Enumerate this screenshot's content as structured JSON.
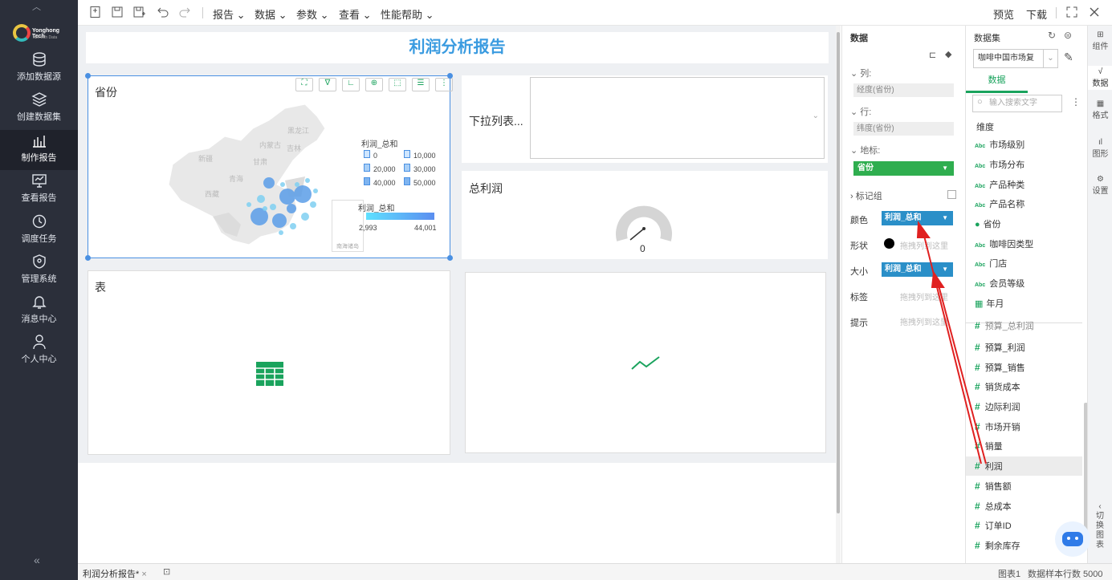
{
  "nav": {
    "logo_text": "Yonghong Tech",
    "logo_sub": "Talk with Data",
    "items": [
      "添加数据源",
      "创建数据集",
      "制作报告",
      "查看报告",
      "调度任务",
      "管理系统",
      "消息中心",
      "个人中心"
    ],
    "collapse": "«"
  },
  "toolbar": {
    "menus": [
      "报告",
      "数据",
      "参数",
      "查看",
      "性能帮助"
    ],
    "preview": "预览",
    "download": "下载"
  },
  "report": {
    "title": "利润分析报告",
    "map_title": "省份",
    "dropdown_label": "下拉列表...",
    "total_profit_title": "总利润",
    "gauge_value": "0",
    "table_title": "表"
  },
  "map": {
    "legend1_title": "利润_总和",
    "legend1_items": [
      "0",
      "10,000",
      "20,000",
      "30,000",
      "40,000",
      "50,000"
    ],
    "legend2_title": "利润_总和",
    "legend2_min": "2,993",
    "legend2_max": "44,001",
    "provinces": [
      "黑龙江",
      "吉林",
      "内蒙古",
      "新疆",
      "青海",
      "西藏",
      "甘肃"
    ],
    "inset": "南海诸岛"
  },
  "pane1": {
    "title": "数据",
    "col_label": "列:",
    "col_value": "经度(省份)",
    "row_label": "行:",
    "row_value": "纬度(省份)",
    "geo_label": "地标:",
    "geo_value": "省份",
    "marks_label": "标记组",
    "color_label": "颜色",
    "color_value": "利润_总和",
    "shape_label": "形状",
    "shape_hint": "拖拽列到这里",
    "size_label": "大小",
    "size_value": "利润_总和",
    "label_label": "标签",
    "label_hint": "拖拽列到这里",
    "tip_label": "提示",
    "tip_hint": "拖拽列到这里"
  },
  "pane2": {
    "title": "数据集",
    "dataset": "咖啡中国市场复",
    "tab": "数据",
    "search_placeholder": "输入搜索文字",
    "dim_title": "维度",
    "dims": [
      "市场级别",
      "市场分布",
      "产品种类",
      "产品名称",
      "省份",
      "咖啡因类型",
      "门店",
      "会员等级",
      "年月"
    ],
    "measures_partial": "预算_总利润",
    "measures": [
      "预算_利润",
      "预算_销售",
      "销货成本",
      "边际利润",
      "市场开销",
      "销量",
      "利润",
      "销售额",
      "总成本",
      "订单ID",
      "剩余库存"
    ]
  },
  "pane3": {
    "items": [
      "组件",
      "数据",
      "格式",
      "图形",
      "设置"
    ],
    "switch": "切换图表"
  },
  "status": {
    "tab": "利润分析报告*",
    "info1": "图表1",
    "info2": "数据样本行数 5000"
  },
  "colors": {
    "accent": "#1aa35d",
    "blue": "#2a8fc8",
    "annotation": "#e02020"
  }
}
